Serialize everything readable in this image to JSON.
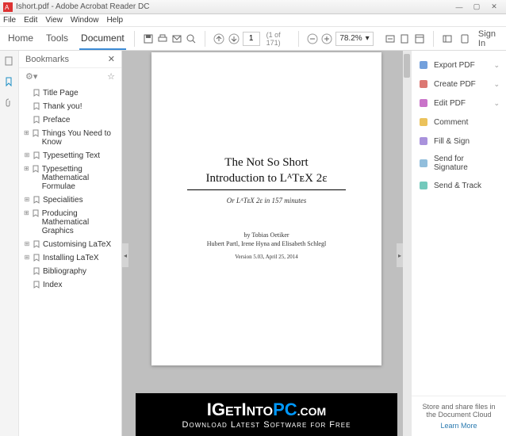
{
  "window": {
    "title": "Ishort.pdf - Adobe Acrobat Reader DC"
  },
  "menubar": [
    "File",
    "Edit",
    "View",
    "Window",
    "Help"
  ],
  "topnav": {
    "home": "Home",
    "tools": "Tools",
    "document": "Document"
  },
  "toolbar": {
    "page_current": "1",
    "page_total": "(1 of 171)",
    "zoom": "78.2%",
    "signin": "Sign In"
  },
  "bookmarks": {
    "title": "Bookmarks",
    "items": [
      {
        "label": "Title Page",
        "expandable": false
      },
      {
        "label": "Thank you!",
        "expandable": false
      },
      {
        "label": "Preface",
        "expandable": false
      },
      {
        "label": "Things You Need to Know",
        "expandable": true
      },
      {
        "label": "Typesetting Text",
        "expandable": true
      },
      {
        "label": "Typesetting Mathematical Formulae",
        "expandable": true
      },
      {
        "label": "Specialities",
        "expandable": true
      },
      {
        "label": "Producing Mathematical Graphics",
        "expandable": true
      },
      {
        "label": "Customising LaTeX",
        "expandable": true
      },
      {
        "label": "Installing LaTeX",
        "expandable": true
      },
      {
        "label": "Bibliography",
        "expandable": false
      },
      {
        "label": "Index",
        "expandable": false
      }
    ]
  },
  "document": {
    "title_line1": "The Not So Short",
    "title_line2": "Introduction to LᴬTᴇX 2ε",
    "subtitle": "Or LᴬTᴇX 2ε in 157 minutes",
    "author1": "by Tobias Oetiker",
    "author2": "Hubert Partl, Irene Hyna and Elisabeth Schlegl",
    "version": "Version 5.03, April 25, 2014"
  },
  "rightpanel": {
    "items": [
      {
        "label": "Export PDF",
        "color": "#5a8fd6",
        "chevron": true
      },
      {
        "label": "Create PDF",
        "color": "#d6605a",
        "chevron": true
      },
      {
        "label": "Edit PDF",
        "color": "#c05ac0",
        "chevron": true
      },
      {
        "label": "Comment",
        "color": "#e8b740",
        "chevron": false
      },
      {
        "label": "Fill & Sign",
        "color": "#9a7fd6",
        "chevron": false
      },
      {
        "label": "Send for Signature",
        "color": "#7fb3d6",
        "chevron": false
      },
      {
        "label": "Send & Track",
        "color": "#5ac0b0",
        "chevron": false
      }
    ],
    "footer_text": "Store and share files in the Document Cloud",
    "footer_link": "Learn More"
  },
  "banner": {
    "line1_a": "IG",
    "line1_b": "ET",
    "line1_c": "I",
    "line1_d": "NTO",
    "line1_e": "PC",
    "line1_f": ".COM",
    "line2": "Download Latest Software for Free"
  }
}
